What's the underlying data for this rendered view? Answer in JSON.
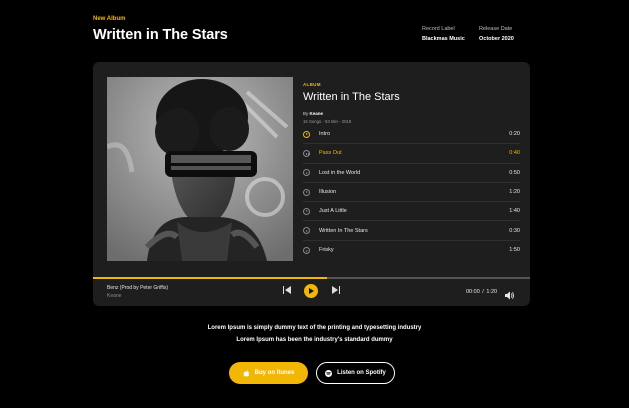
{
  "header": {
    "eyebrow": "New Album",
    "title": "Written in The Stars",
    "record_label_key": "Record Label",
    "record_label_value": "Blackmas Music",
    "release_date_key": "Release Date",
    "release_date_value": "October 2020"
  },
  "album": {
    "tag": "ALBUM",
    "title": "Written in The Stars",
    "by_prefix": "By",
    "artist": "Keane",
    "stats": "15 Songs - 53 Min - 2018",
    "cover_icon": "album-cover-photo"
  },
  "tracks": [
    {
      "name": "Intro",
      "duration": "0:20",
      "state": "play"
    },
    {
      "name": "Pass Out",
      "duration": "0:40",
      "state": "paused-active"
    },
    {
      "name": "Lost in the World",
      "duration": "0:50",
      "state": "play"
    },
    {
      "name": "Illusion",
      "duration": "1:20",
      "state": "play"
    },
    {
      "name": "Just A Little",
      "duration": "1:40",
      "state": "play"
    },
    {
      "name": "Written In The Stars",
      "duration": "0:30",
      "state": "play"
    },
    {
      "name": "Frisky",
      "duration": "1:50",
      "state": "play"
    }
  ],
  "player": {
    "now_playing_title": "Benz (Prod by Peter Griffis)",
    "now_playing_artist": "Keane",
    "current_time": "00:00",
    "separator": "/",
    "total_time": "1:20",
    "progress_fraction": 0.535,
    "prev_icon": "skip-back-icon",
    "play_icon": "play-icon",
    "next_icon": "skip-forward-icon",
    "volume_icon": "volume-icon"
  },
  "description": {
    "line1": "Lorem Ipsum is simply dummy text of the printing and typesetting industry",
    "line2": "Lorem Ipsum has been the industry's standard dummy"
  },
  "buttons": {
    "itunes_label": "Buy on Itunes",
    "spotify_label": "Listen on Spotify"
  },
  "colors": {
    "accent": "#f2b705",
    "background": "#000000",
    "card": "#1e1e1e"
  }
}
